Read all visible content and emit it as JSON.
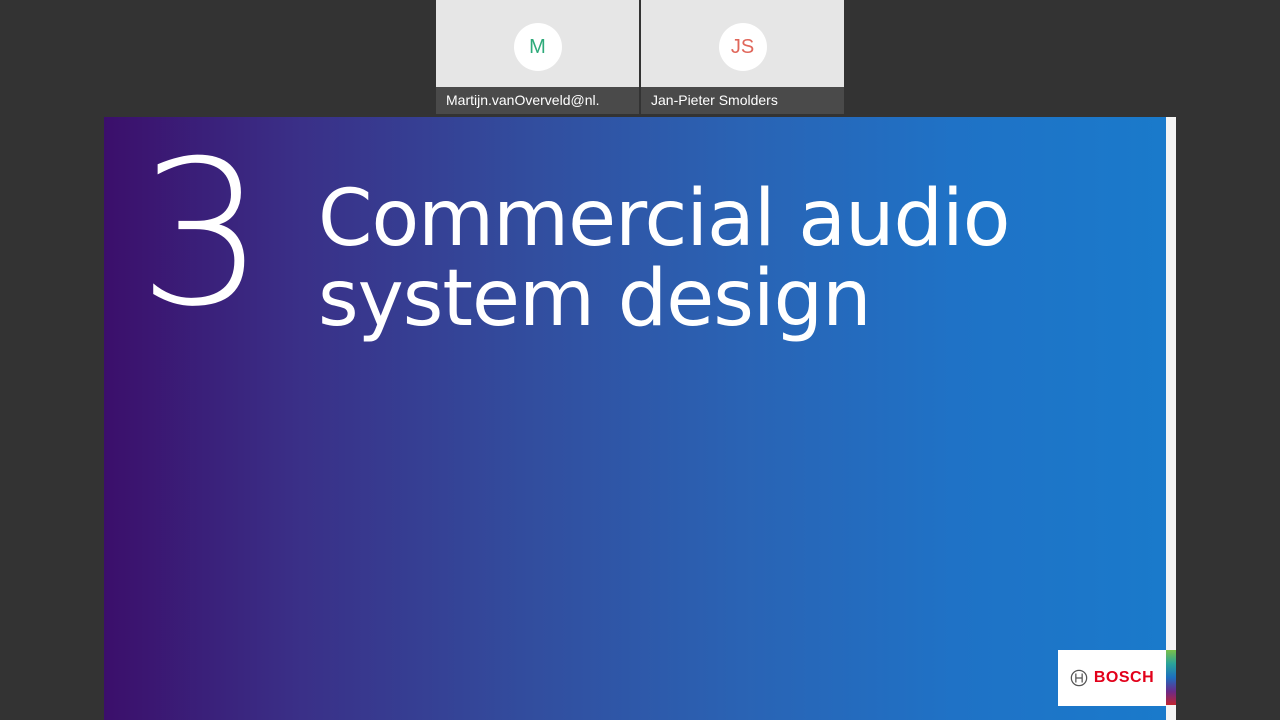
{
  "participants": [
    {
      "initials": "M",
      "name": "Martijn.vanOverveld@nl.",
      "initials_color": "#2eaa7a"
    },
    {
      "initials": "JS",
      "name": "Jan-Pieter Smolders",
      "initials_color": "#e0665a"
    }
  ],
  "slide": {
    "section_number": "3",
    "title_line1": "Commercial audio",
    "title_line2": "system design",
    "brand": "BOSCH",
    "brand_color": "#e2001a"
  },
  "colors": {
    "background": "#333333",
    "gradient_start": "#3b0f6b",
    "gradient_end": "#1a7acb"
  }
}
